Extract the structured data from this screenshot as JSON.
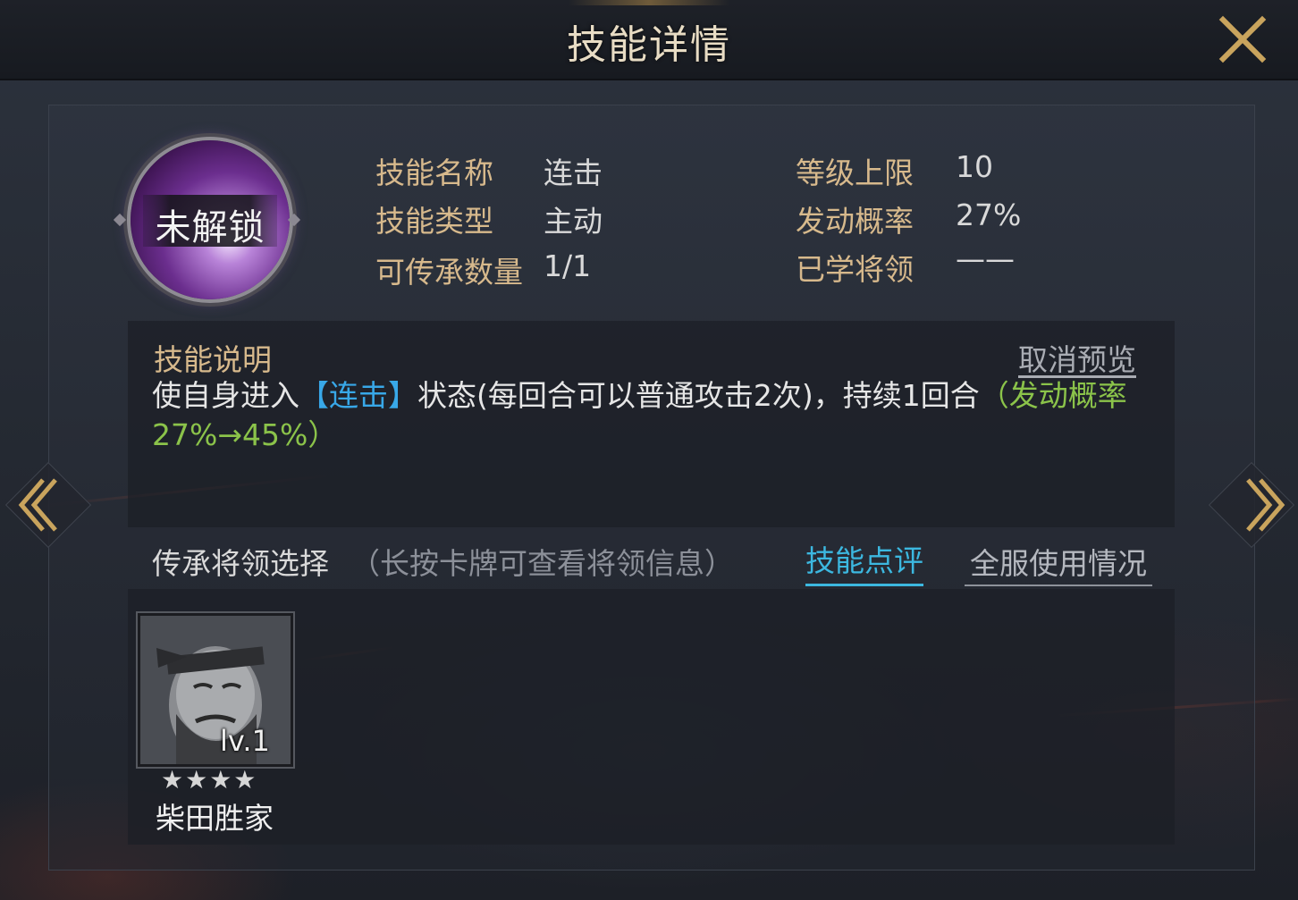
{
  "header": {
    "title": "技能详情"
  },
  "skill": {
    "lock_status": "未解锁",
    "name_label": "技能名称",
    "name_value": "连击",
    "type_label": "技能类型",
    "type_value": "主动",
    "inherit_count_label": "可传承数量",
    "inherit_count_value": "1/1",
    "level_cap_label": "等级上限",
    "level_cap_value": "10",
    "trigger_rate_label": "发动概率",
    "trigger_rate_value": "27%",
    "learned_by_label": "已学将领",
    "learned_by_value": "——"
  },
  "description": {
    "title": "技能说明",
    "cancel_preview": "取消预览",
    "text_prefix": "使自身进入",
    "text_highlight": "【连击】",
    "text_middle": "状态(每回合可以普通攻击2次)，持续1回合",
    "text_green": "（发动概率27%→45%）"
  },
  "inherit": {
    "label": "传承将领选择",
    "hint": "（长按卡牌可查看将领信息）",
    "review_link": "技能点评",
    "usage_link": "全服使用情况"
  },
  "generals": [
    {
      "name": "柴田胜家",
      "level": "lv.1",
      "stars": "★★★★"
    }
  ],
  "colors": {
    "label_gold": "#d7b98c",
    "link_cyan": "#3cb8e0",
    "highlight_blue": "#38a8e8",
    "highlight_green": "#8bc34a",
    "arrow_gold": "#c9a45d"
  },
  "icons": {
    "close": "close-icon",
    "prev": "chevron-left-icon",
    "next": "chevron-right-icon"
  }
}
